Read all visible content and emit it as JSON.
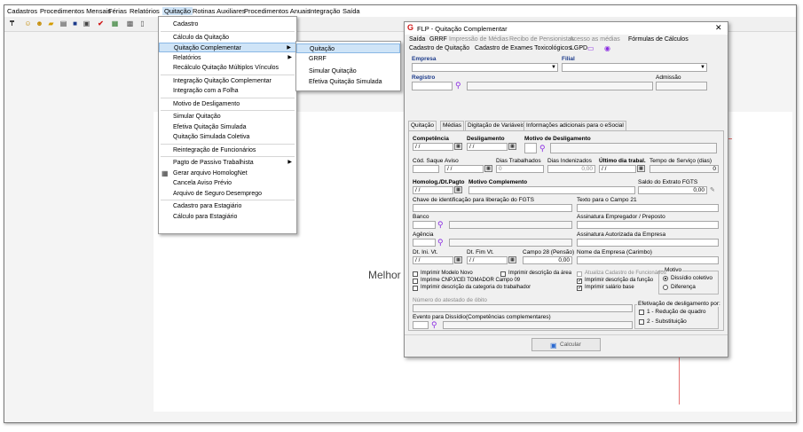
{
  "menubar": [
    "Cadastros",
    "Procedimentos Mensais",
    "Férias",
    "Relatórios",
    "Quitação",
    "Rotinas Auxiliares",
    "Procedimentos Anuais",
    "Integração",
    "Saída"
  ],
  "toolbar_icons": [
    "pin-icon",
    "users-icon",
    "group-icon",
    "folder-icon",
    "document-icon",
    "save-icon",
    "print-icon",
    "check-icon",
    "chart-icon",
    "calculator-icon",
    "file-icon"
  ],
  "colors": {
    "highlight": "#cfe4f7",
    "accent_red": "#e57373",
    "link_purple": "#8a2be2"
  },
  "quitacao_menu": [
    {
      "label": "Cadastro",
      "sep_after": true
    },
    {
      "label": "Cálculo da Quitação"
    },
    {
      "label": "Quitação Complementar",
      "submenu": true,
      "highlighted": true
    },
    {
      "label": "Relatórios",
      "submenu": true
    },
    {
      "label": "Recálculo Quitação Múltiplos Vínculos",
      "sep_after": true
    },
    {
      "label": "Integração Quitação Complementar"
    },
    {
      "label": "Integração com a Folha",
      "sep_after": true
    },
    {
      "label": "Motivo de Desligamento",
      "sep_after": true
    },
    {
      "label": "Simular Quitação"
    },
    {
      "label": "Efetiva Quitação Simulada"
    },
    {
      "label": "Quitação Simulada Coletiva",
      "sep_after": true
    },
    {
      "label": "Reintegração de Funcionários",
      "sep_after": true
    },
    {
      "label": "Pagto de Passivo Trabalhista",
      "submenu": true
    },
    {
      "label": "Gerar arquivo HomologNet",
      "icon": true
    },
    {
      "label": "Cancela Aviso Prévio"
    },
    {
      "label": "Arquivo de Seguro Desemprego",
      "sep_after": true
    },
    {
      "label": "Cadastro para Estagiário"
    },
    {
      "label": "Cálculo para Estagiário"
    }
  ],
  "submenu": [
    {
      "label": "Quitação",
      "highlighted": true
    },
    {
      "label": "GRRF"
    },
    {
      "label": "Simular Quitação"
    },
    {
      "label": "Efetiva Quitação Simulada"
    }
  ],
  "background_text": "Melhor",
  "dialog": {
    "title": "FLP - Quitação Complementar",
    "menu_row1": [
      {
        "label": "Saída",
        "disabled": false
      },
      {
        "label": "GRRF",
        "disabled": false
      },
      {
        "label": "Impressão de Médias",
        "disabled": true
      },
      {
        "label": "Recibo de Pensionistas",
        "disabled": true
      },
      {
        "label": "Acesso as médias",
        "disabled": true
      },
      {
        "label": "Fórmulas de Cálculos",
        "disabled": false
      }
    ],
    "menu_row2": [
      "Cadastro de Quitação",
      "Cadastro de Exames Toxicológicos",
      "LGPD"
    ],
    "empresa_label": "Empresa",
    "filial_label": "Filial",
    "registro_label": "Registro",
    "admissao_label": "Admissão",
    "tabs": [
      "Quitação",
      "Médias",
      "Digitação de Variáveis",
      "Informações adicionais para o eSocial"
    ],
    "competencia_label": "Competência",
    "competencia_value": "/ /",
    "desligamento_label": "Desligamento",
    "desligamento_value": "/ /",
    "motivo_label": "Motivo de Desligamento",
    "cod_saque_label": "Cód. Saque",
    "aviso_label": "Aviso",
    "aviso_value": "/ /",
    "dias_trab_label": "Dias Trabalhados",
    "dias_trab_value": "0",
    "dias_inden_label": "Dias Indenizados",
    "dias_inden_value": "0,00",
    "ultimo_dia_label": "Último dia trabal.",
    "ultimo_dia_value": "/ /",
    "tempo_servico_label": "Tempo de Serviço (dias)",
    "tempo_servico_value": "0",
    "homolog_label": "Homolog./Dt.Pagto",
    "homolog_value": "/ /",
    "motivo_compl_label": "Motivo Complemento",
    "saldo_fgts_label": "Saldo do Extrato FGTS",
    "saldo_fgts_value": "0,00",
    "chave_fgts_label": "Chave de identificação para liberação do FGTS",
    "texto_campo21_label": "Texto para o Campo 21",
    "banco_label": "Banco",
    "assinatura_emp_label": "Assinatura Empregador / Preposto",
    "agencia_label": "Agência",
    "assinatura_aut_label": "Assinatura Autorizada da Empresa",
    "dt_ini_vt_label": "Dt. Ini. Vt.",
    "dt_ini_vt_value": "/ /",
    "dt_fim_vt_label": "Dt. Fim Vt.",
    "dt_fim_vt_value": "/ /",
    "campo28_label": "Campo 28 (Pensão)",
    "campo28_value": "0,00",
    "nome_empresa_label": "Nome da Empresa (Carimbo)",
    "checkboxes": [
      {
        "label": "Imprimir Modelo Novo",
        "checked": false,
        "disabled": false
      },
      {
        "label": "Imprimir descrição da área",
        "checked": false,
        "disabled": false
      },
      {
        "label": "Atualiza Cadastro de Funcionários",
        "checked": false,
        "disabled": true
      },
      {
        "label": "Imprime CNPJ/CEI TOMADOR Campo 09",
        "checked": false,
        "disabled": false
      },
      {
        "label": "Imprimir descrição da função",
        "checked": true,
        "disabled": false
      },
      {
        "label": "Imprimir descrição da categoria do trabalhador",
        "checked": false,
        "disabled": false
      },
      {
        "label": "Imprimir salário base",
        "checked": true,
        "disabled": false
      }
    ],
    "motivo_group_label": "Motivo",
    "motivo_options": [
      {
        "label": "Dissídio coletivo",
        "selected": true
      },
      {
        "label": "Diferença",
        "selected": false
      }
    ],
    "numero_atestado_label": "Número do atestado de óbito",
    "evento_label": "Evento para Dissídio(Competências complementares)",
    "efetivacao_label": "Efetivação de desligamento por:",
    "efetivacao_options": [
      "1 - Redução de quadro",
      "2 - Substituição"
    ],
    "calcular_label": "Calcular"
  }
}
